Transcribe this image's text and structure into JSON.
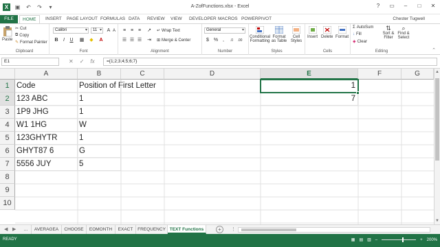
{
  "window": {
    "title": "A-ZofFunctions.xlsx - Excel",
    "user": "Chester Tugwell",
    "controls": [
      "?",
      "▭",
      "–",
      "□",
      "✕"
    ]
  },
  "qat": {
    "logo": "X",
    "save": "▣",
    "undo": "↶",
    "redo": "↷",
    "customize": "▾"
  },
  "ribbon_tabs": [
    {
      "label": "FILE"
    },
    {
      "label": "HOME"
    },
    {
      "label": "INSERT"
    },
    {
      "label": "PAGE LAYOUT"
    },
    {
      "label": "FORMULAS"
    },
    {
      "label": "DATA"
    },
    {
      "label": "REVIEW"
    },
    {
      "label": "VIEW"
    },
    {
      "label": "DEVELOPER"
    },
    {
      "label": "MACROS"
    },
    {
      "label": "POWERPIVOT"
    }
  ],
  "ribbon": {
    "clipboard": {
      "label": "Clipboard",
      "paste": "Paste",
      "cut": "Cut",
      "copy": "Copy",
      "format_painter": "Format Painter"
    },
    "font": {
      "label": "Font",
      "name": "Calibri",
      "size": "11",
      "bold": "B",
      "italic": "I",
      "underline": "U"
    },
    "alignment": {
      "label": "Alignment",
      "wrap": "Wrap Text",
      "merge": "Merge & Center"
    },
    "number": {
      "label": "Number",
      "format": "General",
      "currency": "$",
      "percent": "%",
      "comma": ","
    },
    "styles": {
      "label": "Styles",
      "conditional": "Conditional Formatting",
      "table": "Format as Table",
      "cell_styles": "Cell Styles"
    },
    "cells": {
      "label": "Cells",
      "insert": "Insert",
      "delete": "Delete",
      "format": "Format"
    },
    "editing": {
      "label": "Editing",
      "autosum": "AutoSum",
      "fill": "Fill",
      "clear": "Clear",
      "sort": "Sort & Filter",
      "find": "Find & Select"
    }
  },
  "formula_bar": {
    "name_box": "E1",
    "cancel": "✕",
    "enter": "✓",
    "fx": "fx",
    "formula": "={1;2;3;4;5;6;7}"
  },
  "columns": [
    "A",
    "B",
    "C",
    "D",
    "E",
    "F",
    "G"
  ],
  "rows": [
    "1",
    "2",
    "3",
    "4",
    "5",
    "6",
    "7",
    "8",
    "9",
    "10"
  ],
  "cells": {
    "A1": "Code",
    "B1": "Position of First Letter",
    "A2": "123 ABC",
    "B2": "1",
    "A3": "1P9 JHG",
    "B3": "1",
    "A4": "W1 1HG",
    "B4": "W",
    "A5": "123GHYTR",
    "B5": "1",
    "A6": "GHYT87 6",
    "B6": "G",
    "A7": "5556 JUY",
    "B7": "5",
    "E1": "1",
    "E2": "7"
  },
  "sheet_tabs": {
    "ellipsis": "...",
    "tabs": [
      "AVERAGEA",
      "CHOOSE",
      "EOMONTH",
      "EXACT",
      "FREQUENCY",
      "TEXT Functions"
    ],
    "active": "TEXT Functions",
    "add": "+"
  },
  "status": {
    "mode": "READY",
    "zoom": "200%"
  },
  "colors": {
    "accent": "#217346"
  }
}
